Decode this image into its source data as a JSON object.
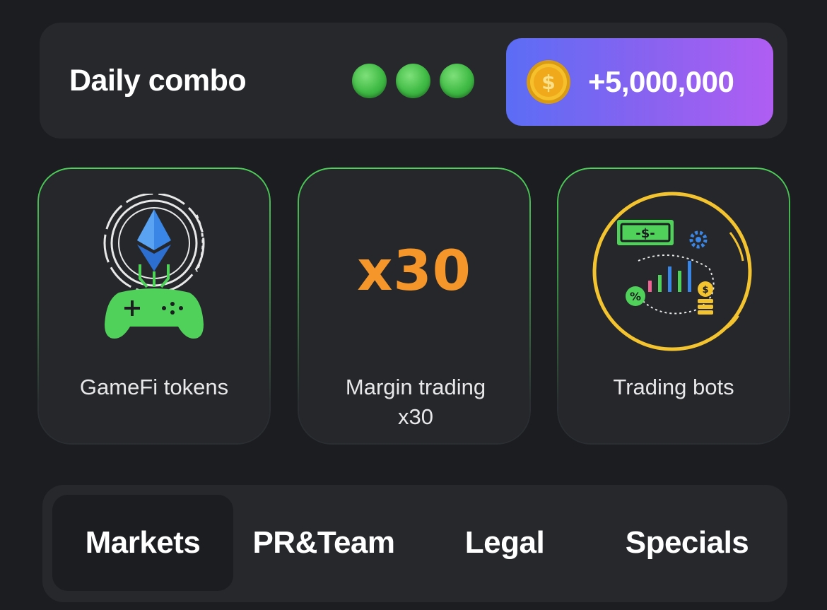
{
  "daily_combo": {
    "title": "Daily combo",
    "progress_dots": {
      "filled": 3,
      "total": 3,
      "color": "#3fba44"
    },
    "reward": {
      "value": "+5,000,000",
      "icon": "coin-icon",
      "gradient": [
        "#5b6df5",
        "#b05ef2"
      ]
    }
  },
  "cards": [
    {
      "label": "GameFi tokens",
      "icon": "gamefi-controller-icon"
    },
    {
      "label": "Margin trading x30",
      "art_text": "x30",
      "icon": "x30-icon"
    },
    {
      "label": "Trading bots",
      "icon": "trading-bots-icon"
    }
  ],
  "tabs": [
    {
      "label": "Markets",
      "active": true
    },
    {
      "label": "PR&Team",
      "active": false
    },
    {
      "label": "Legal",
      "active": false
    },
    {
      "label": "Specials",
      "active": false
    }
  ],
  "colors": {
    "background": "#1b1d20",
    "panel": "#26282c",
    "card_border": "#4fd15a",
    "accent_orange": "#f5962a",
    "accent_yellow": "#f4c430"
  }
}
